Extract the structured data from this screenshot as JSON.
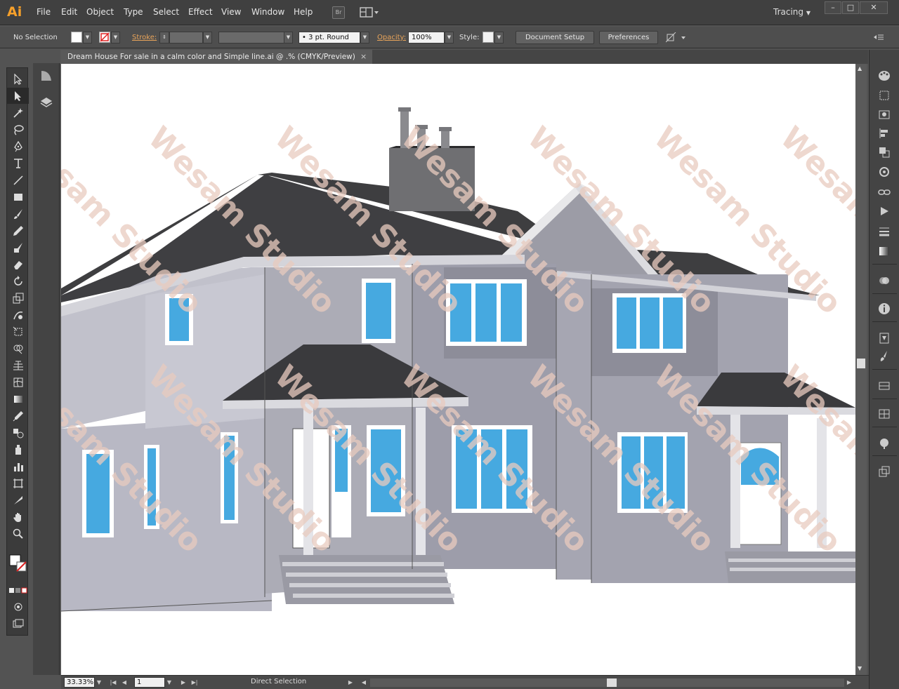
{
  "app": {
    "logo": "Ai",
    "brand_color": "#f7a02a"
  },
  "menu": {
    "items": [
      "File",
      "Edit",
      "Object",
      "Type",
      "Select",
      "Effect",
      "View",
      "Window",
      "Help"
    ]
  },
  "bridge_button": "Br",
  "workspace": {
    "label": "Tracing"
  },
  "window_controls": {
    "minimize": "–",
    "maximize": "□",
    "close": "✕"
  },
  "control": {
    "selection": "No Selection",
    "stroke_label": "Stroke:",
    "brush_value": "3 pt. Round",
    "opacity_label": "Opacity:",
    "opacity_value": "100%",
    "style_label": "Style:",
    "document_setup": "Document Setup",
    "preferences": "Preferences"
  },
  "document": {
    "tab_title": "Dream House For sale in a calm color and Simple line.ai @ .% (CMYK/Preview)",
    "close": "×"
  },
  "watermark": {
    "text": "Wesam Studio",
    "color": "#e9cbbf"
  },
  "status": {
    "zoom": "33.33%",
    "page": "1",
    "tool": "Direct Selection"
  },
  "tools": [
    "selection-tool",
    "direct-selection-tool",
    "magic-wand-tool",
    "lasso-tool",
    "pen-tool",
    "type-tool",
    "line-tool",
    "rectangle-tool",
    "paintbrush-tool",
    "pencil-tool",
    "blob-brush-tool",
    "eraser-tool",
    "rotate-tool",
    "scale-tool",
    "warp-tool",
    "free-transform-tool",
    "shape-builder-tool",
    "perspective-grid-tool",
    "mesh-tool",
    "gradient-tool",
    "eyedropper-tool",
    "blend-tool",
    "symbol-sprayer-tool",
    "column-graph-tool",
    "artboard-tool",
    "slice-tool",
    "hand-tool",
    "zoom-tool"
  ]
}
